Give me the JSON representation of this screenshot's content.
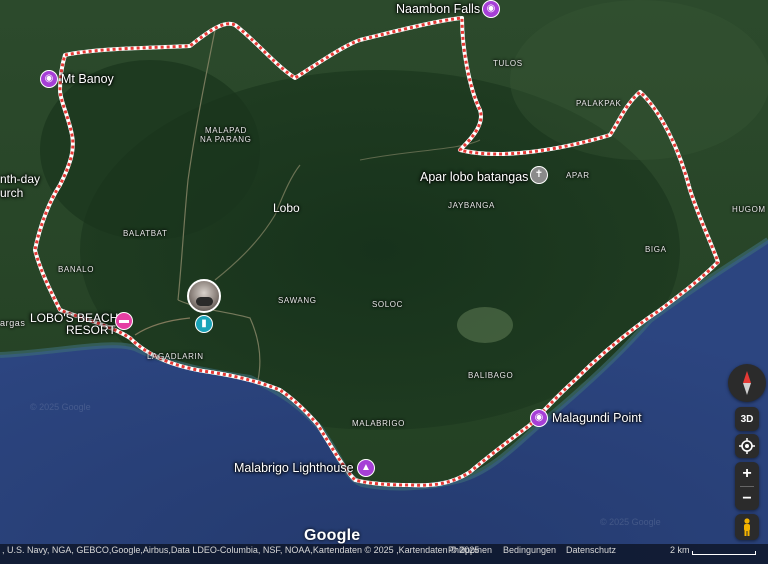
{
  "colors": {
    "boundary": "#e53935",
    "pin_sight": "#a63fd6",
    "pin_hotel": "#e53fa3",
    "pin_church": "#8a8a8a",
    "saved_pin": "#1aa3b8"
  },
  "places": {
    "naambon_falls": "Naambon Falls",
    "mt_banoy": "Mt Banoy",
    "church_partial_1": "nth-day",
    "church_partial_2": "urch",
    "apar_lobo_batangas": "Apar lobo batangas",
    "lobos_beach_resort_1": "LOBO'S BEACH",
    "lobos_beach_resort_2": "RESORT",
    "malagundi_point": "Malagundi Point",
    "malabrigo_lighthouse": "Malabrigo Lighthouse"
  },
  "towns": {
    "lobo": "Lobo",
    "tulos": "TULOS",
    "palakpak": "PALAKPAK",
    "malapad_1": "MALAPAD",
    "malapad_2": "NA PARANG",
    "apar": "APAR",
    "jaybanga": "JAYBANGA",
    "hugom": "HUGOM",
    "balatbat": "BALATBAT",
    "biga": "BIGA",
    "banalo": "BANALO",
    "sawang": "SAWANG",
    "soloc": "SOLOC",
    "lagadlarin": "LAGADLARIN",
    "balibago": "BALIBAGO",
    "malabrigo": "MALABRIGO",
    "road_partial": "argas"
  },
  "icons": {
    "camera": "camera-icon",
    "hotel": "bed-icon",
    "church": "cross-icon",
    "lighthouse": "lighthouse-icon",
    "saved": "bookmark-icon"
  },
  "controls": {
    "view_3d": "3D",
    "zoom_in": "+",
    "zoom_out": "−"
  },
  "google_logo": "Google",
  "footer": {
    "attribution": ", U.S. Navy, NGA, GEBCO,Google,Airbus,Data LDEO-Columbia, NSF, NOAA,Kartendaten © 2025 ,Kartendaten © 2025",
    "country": "Philippinen",
    "terms": "Bedingungen",
    "privacy": "Datenschutz",
    "scale": "2 km"
  }
}
